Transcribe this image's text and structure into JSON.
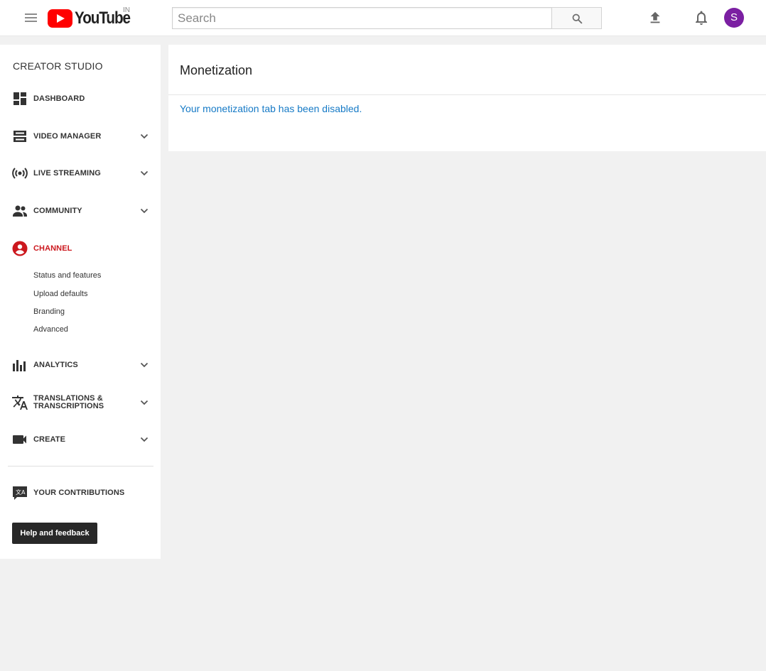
{
  "header": {
    "logo_text": "YouTube",
    "logo_country": "IN",
    "search_placeholder": "Search",
    "avatar_initial": "S",
    "avatar_color": "#7b1fa2",
    "brand_color": "#ff0000"
  },
  "sidebar": {
    "title": "CREATOR STUDIO",
    "items": [
      {
        "label": "DASHBOARD",
        "icon": "dashboard-icon",
        "expandable": false
      },
      {
        "label": "VIDEO MANAGER",
        "icon": "video-manager-icon",
        "expandable": true
      },
      {
        "label": "LIVE STREAMING",
        "icon": "live-streaming-icon",
        "expandable": true
      },
      {
        "label": "COMMUNITY",
        "icon": "community-icon",
        "expandable": true
      },
      {
        "label": "CHANNEL",
        "icon": "channel-icon",
        "expandable": false,
        "active": true
      },
      {
        "label": "ANALYTICS",
        "icon": "analytics-icon",
        "expandable": true
      },
      {
        "label": "TRANSLATIONS & TRANSCRIPTIONS",
        "label_line1": "TRANSLATIONS &",
        "label_line2": "TRANSCRIPTIONS",
        "icon": "translate-icon",
        "expandable": true
      },
      {
        "label": "CREATE",
        "icon": "create-icon",
        "expandable": true
      },
      {
        "label": "YOUR CONTRIBUTIONS",
        "icon": "contributions-icon",
        "expandable": false
      }
    ],
    "channel_subitems": [
      "Status and features",
      "Upload defaults",
      "Branding",
      "Advanced"
    ],
    "help_button": "Help and feedback",
    "active_color": "#cc181e"
  },
  "main": {
    "title": "Monetization",
    "message": "Your monetization tab has been disabled.",
    "message_color": "#167ac6"
  }
}
